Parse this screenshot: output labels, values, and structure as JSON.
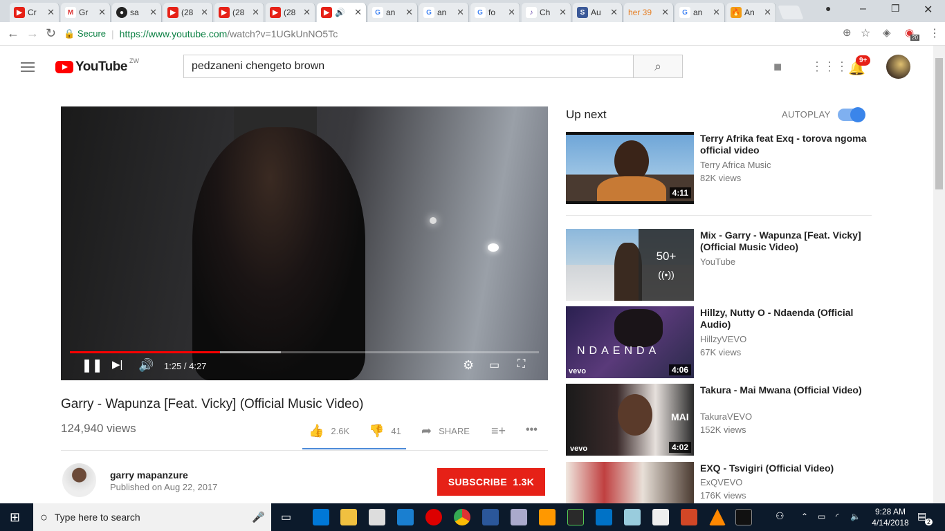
{
  "browser": {
    "tabs": [
      {
        "label": "Cr",
        "favicon": "yt"
      },
      {
        "label": "Gr",
        "favicon": "gmail"
      },
      {
        "label": "sa",
        "favicon": "github"
      },
      {
        "label": "(28",
        "favicon": "yt"
      },
      {
        "label": "(28",
        "favicon": "yt"
      },
      {
        "label": "(28",
        "favicon": "yt"
      },
      {
        "label": "",
        "favicon": "yt"
      },
      {
        "label": "an",
        "favicon": "google"
      },
      {
        "label": "an",
        "favicon": "google"
      },
      {
        "label": "fo",
        "favicon": "google"
      },
      {
        "label": "Ch",
        "favicon": "guitar"
      },
      {
        "label": "Au",
        "favicon": "s"
      },
      {
        "label": "her 39",
        "favicon": "her"
      },
      {
        "label": "an",
        "favicon": "google"
      },
      {
        "label": "An",
        "favicon": "fire"
      }
    ],
    "secure_label": "Secure",
    "url_base": "https://www.youtube.com",
    "url_path": "/watch?v=1UGkUnNO5Tc",
    "ext_badge": "20"
  },
  "header": {
    "logo_word": "YouTube",
    "country_code": "ZW",
    "search_value": "pedzaneni chengeto brown",
    "notif_badge": "9+"
  },
  "player": {
    "time": "1:25 / 4:27",
    "progress_played": 0.32,
    "progress_loaded": 0.45
  },
  "video": {
    "title": "Garry - Wapunza [Feat. Vicky] (Official Music Video)",
    "views": "124,940 views",
    "likes": "2.6K",
    "dislikes": "41",
    "share_label": "SHARE"
  },
  "channel": {
    "name": "garry mapanzure",
    "published": "Published on Aug 22, 2017",
    "subscribe_label": "SUBSCRIBE",
    "subscriber_count": "1.3K"
  },
  "sidebar": {
    "up_next_label": "Up next",
    "autoplay_label": "AUTOPLAY",
    "autoplay_on": true,
    "items": [
      {
        "title": "Terry Afrika feat Exq - torova ngoma official video",
        "channel": "Terry Africa Music",
        "views": "82K views",
        "duration": "4:11"
      },
      {
        "title": "Mix - Garry - Wapunza [Feat. Vicky] (Official Music Video)",
        "channel": "YouTube",
        "views": "",
        "mix_count": "50+"
      },
      {
        "title": "Hillzy, Nutty O - Ndaenda (Official Audio)",
        "channel": "HillzyVEVO",
        "views": "67K views",
        "duration": "4:06",
        "thumb_text": "NDAENDA"
      },
      {
        "title": "Takura - Mai Mwana (Official Video)",
        "channel": "TakuraVEVO",
        "views": "152K views",
        "duration": "4:02",
        "thumb_text": "MAI"
      },
      {
        "title": "EXQ - Tsvigiri (Official Video)",
        "channel": "ExQVEVO",
        "views": "176K views",
        "duration": ""
      }
    ]
  },
  "taskbar": {
    "search_placeholder": "Type here to search",
    "clock_time": "9:28 AM",
    "clock_date": "4/14/2018",
    "notif_count": "2"
  },
  "colors": {
    "youtube_red": "#e62117",
    "autoplay_blue": "#3a85ea",
    "taskbar_bg": "#0c1a2b"
  }
}
